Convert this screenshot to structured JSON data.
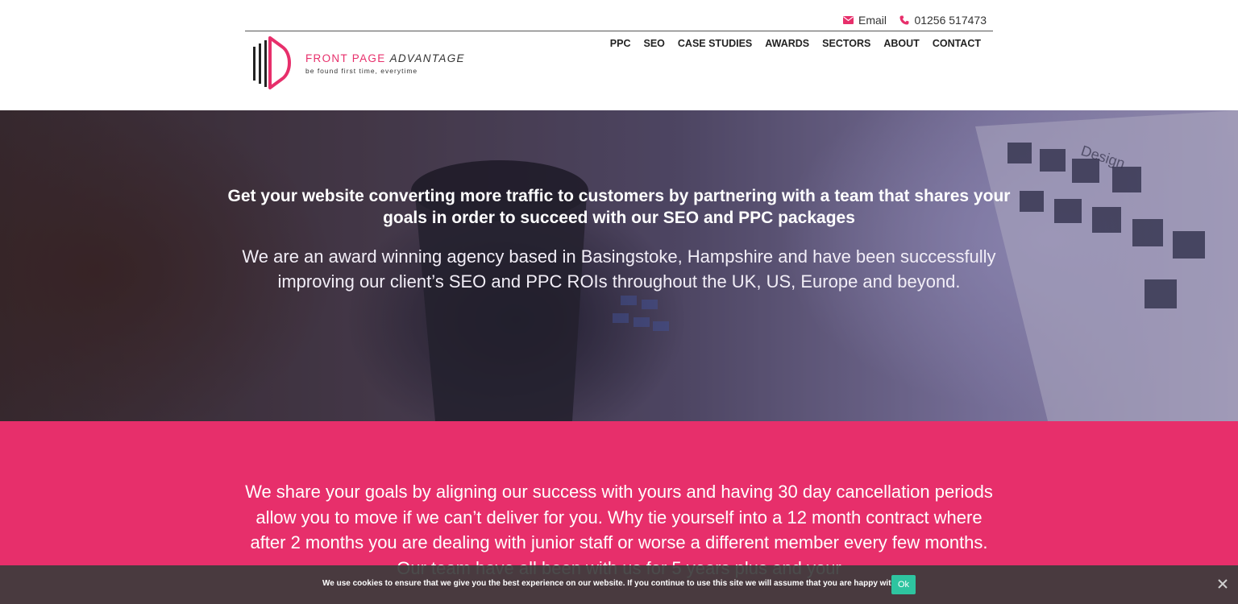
{
  "header": {
    "email_label": "Email",
    "phone_label": "01256 517473",
    "logo": {
      "name_part1": "FRONT PAGE",
      "name_part2": "ADVANTAGE",
      "tagline": "be found first time, everytime"
    },
    "nav": [
      "PPC",
      "SEO",
      "CASE STUDIES",
      "AWARDS",
      "SECTORS",
      "ABOUT",
      "CONTACT"
    ]
  },
  "hero": {
    "heading": "Get your website converting more traffic to customers by partnering with a team that shares your goals in order to succeed with our SEO and PPC packages",
    "subtext": "We are an award winning agency based in Basingstoke, Hampshire and have been successfully improving our client’s SEO and PPC ROIs throughout the UK, US, Europe and beyond.",
    "laptop_screen_text": "Design"
  },
  "pink_section": {
    "text": "We share your goals by aligning our success with yours and having 30 day cancellation periods allow you to move if we can’t deliver for you. Why tie yourself into a 12 month contract where after 2 months you are dealing with junior staff or worse a different member every few months. Our team have all been with us for 5 years plus and your"
  },
  "cookie_bar": {
    "message": "We use cookies to ensure that we give you the best experience on our website. If you continue to use this site we will assume that you are happy with it.",
    "ok_label": "Ok"
  },
  "colors": {
    "brand_pink": "#e72f6b",
    "cookie_ok": "#2ec4a0",
    "text_dark": "#222222"
  },
  "icons": {
    "email": "envelope-icon",
    "phone": "phone-icon",
    "close": "close-icon"
  }
}
